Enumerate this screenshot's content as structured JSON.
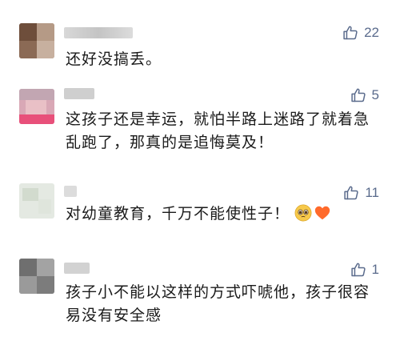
{
  "comments": [
    {
      "likes": "22",
      "text": "还好没搞丢。",
      "icons": [
        "thumbs-up-icon"
      ]
    },
    {
      "likes": "5",
      "text_lines": [
        "这孩子还是幸运，就怕半路上迷路了就着急",
        "乱跑了，那真的是追悔莫及！"
      ],
      "icons": [
        "thumbs-up-icon"
      ]
    },
    {
      "likes": "11",
      "text": "对幼童教育，千万不能使性子！",
      "icons": [
        "thumbs-up-icon",
        "pleading-face-emoji",
        "orange-heart-emoji"
      ]
    },
    {
      "likes": "1",
      "text_lines": [
        "孩子小不能以这样的方式吓唬他，孩子很容",
        "易没有安全感"
      ],
      "icons": [
        "thumbs-up-icon"
      ]
    }
  ],
  "colors": {
    "like_icon": "#5a6b8c",
    "text": "#1a1a1a",
    "heart": "#ff6a2b"
  }
}
